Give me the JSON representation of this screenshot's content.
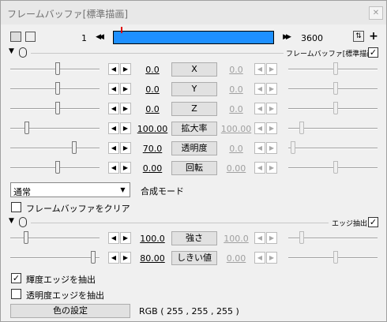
{
  "window": {
    "title": "フレームバッファ[標準描画]"
  },
  "toolbar": {
    "frame_start": "1",
    "frame_end": "3600",
    "prev": "◀◀",
    "next": "▶▶"
  },
  "section1": {
    "label": "フレームバッファ[標準描画]",
    "checked": true
  },
  "params": [
    {
      "label": "X",
      "value": "0.0",
      "value2": "0.0"
    },
    {
      "label": "Y",
      "value": "0.0",
      "value2": "0.0"
    },
    {
      "label": "Z",
      "value": "0.0",
      "value2": "0.0"
    },
    {
      "label": "拡大率",
      "value": "100.00",
      "value2": "100.00"
    },
    {
      "label": "透明度",
      "value": "70.0",
      "value2": "0.0"
    },
    {
      "label": "回転",
      "value": "0.00",
      "value2": "0.00"
    }
  ],
  "blend": {
    "selected": "通常",
    "label": "合成モード"
  },
  "clear_framebuffer": {
    "label": "フレームバッファをクリア",
    "checked": false
  },
  "section2": {
    "label": "エッジ抽出",
    "checked": true
  },
  "edge_params": [
    {
      "label": "強さ",
      "value": "100.0",
      "value2": "100.0"
    },
    {
      "label": "しきい値",
      "value": "80.00",
      "value2": "0.00"
    }
  ],
  "luma_edge": {
    "label": "輝度エッジを抽出",
    "checked": true
  },
  "alpha_edge": {
    "label": "透明度エッジを抽出",
    "checked": false
  },
  "color": {
    "button": "色の設定",
    "value": "RGB ( 255 , 255 , 255 )"
  }
}
